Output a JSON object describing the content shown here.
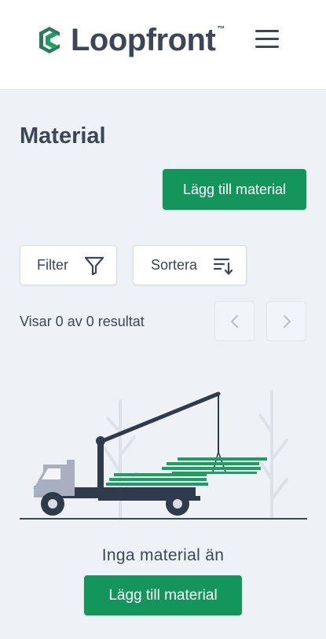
{
  "header": {
    "logo_text": "Loopfront",
    "logo_tm": "™"
  },
  "main": {
    "title": "Material",
    "add_button": "Lägg till material",
    "filter_label": "Filter",
    "sort_label": "Sortera",
    "results_text": "Visar 0 av 0 resultat",
    "empty_text": "Inga material än",
    "empty_add_button": "Lägg till material"
  },
  "colors": {
    "brand_green": "#13955c",
    "text_dark": "#3b4656",
    "background": "#eef2f7"
  },
  "icons": {
    "logo": "loopfront-logo-icon",
    "menu": "hamburger-menu-icon",
    "filter": "funnel-icon",
    "sort": "sort-descending-icon",
    "prev": "chevron-left-icon",
    "next": "chevron-right-icon"
  }
}
